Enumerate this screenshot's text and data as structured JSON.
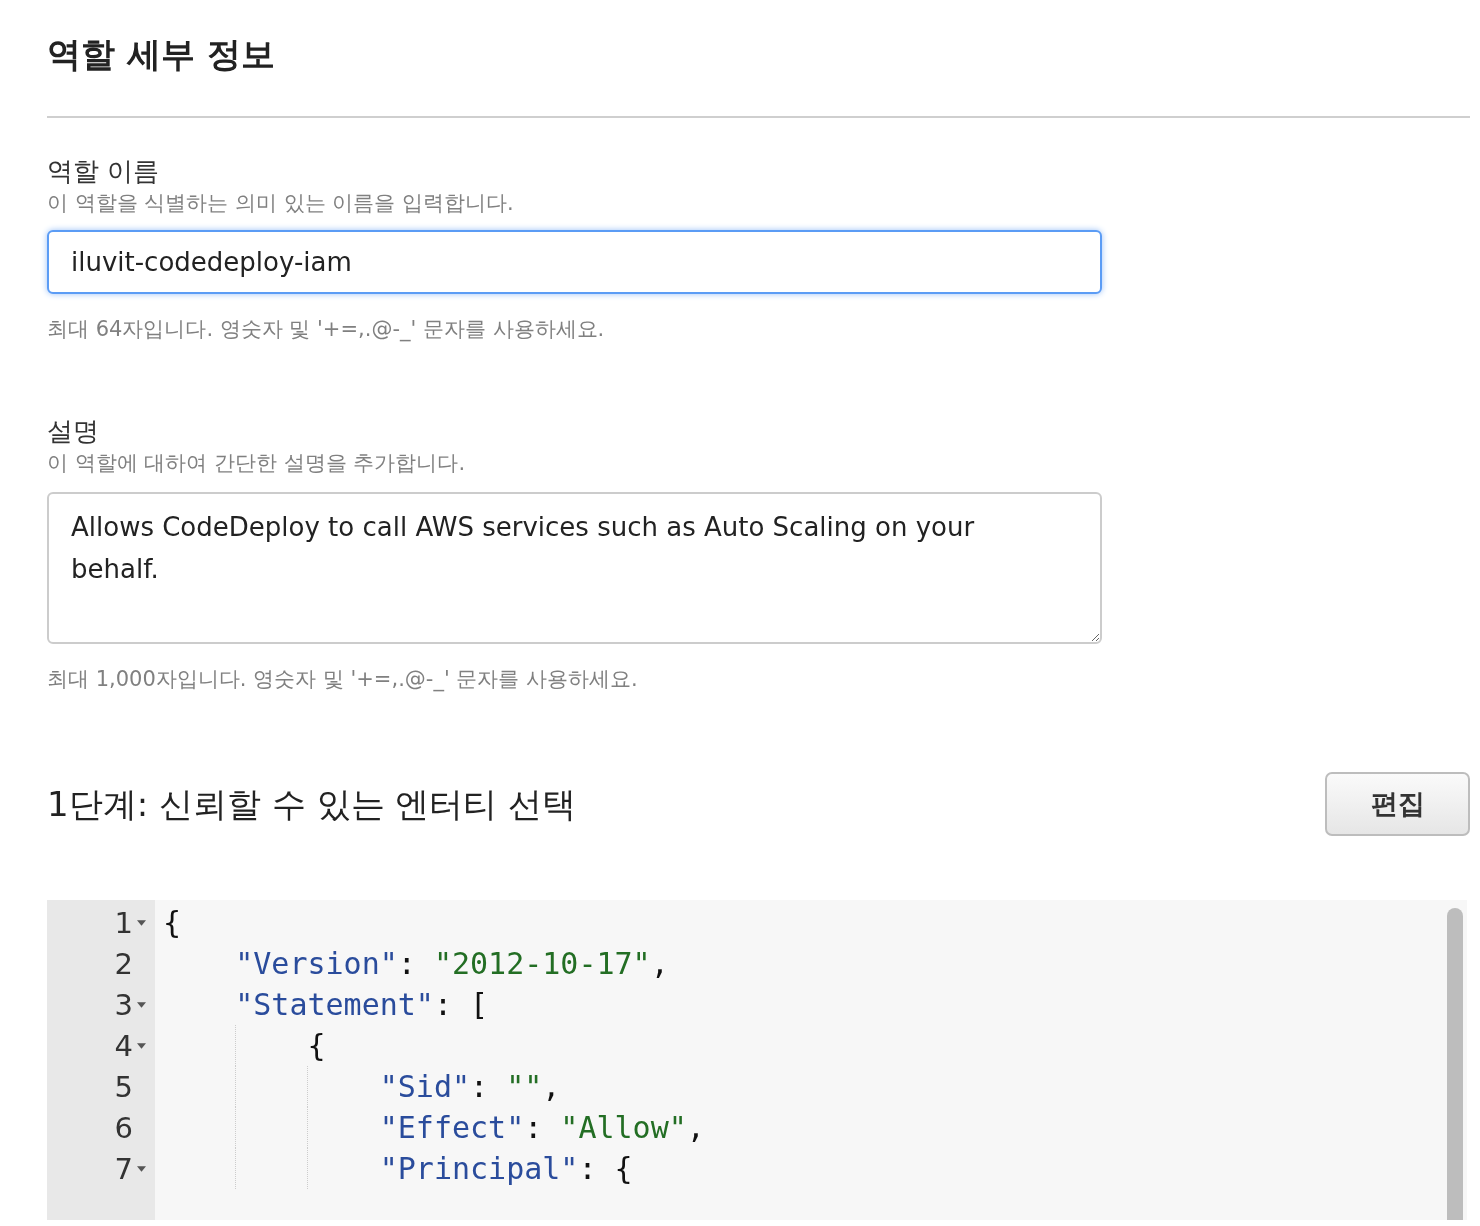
{
  "title": "역할 세부 정보",
  "role_name": {
    "label": "역할 이름",
    "help": "이 역할을 식별하는 의미 있는 이름을 입력합니다.",
    "value": "iluvit-codedeploy-iam",
    "hint": "최대 64자입니다. 영숫자 및 '+=,.@-_' 문자를 사용하세요."
  },
  "description": {
    "label": "설명",
    "help": "이 역할에 대하여 간단한 설명을 추가합니다.",
    "value": "Allows CodeDeploy to call AWS services such as Auto Scaling on your behalf.",
    "hint": "최대 1,000자입니다. 영숫자 및 '+=,.@-_' 문자를 사용하세요."
  },
  "step": {
    "heading": "1단계: 신뢰할 수 있는 엔터티 선택",
    "edit_button": "편집"
  },
  "editor": {
    "lines": [
      {
        "number": "1",
        "foldable": true,
        "tokens": [
          {
            "kind": "punct",
            "text": "{"
          }
        ]
      },
      {
        "number": "2",
        "foldable": false,
        "tokens": [
          {
            "kind": "key",
            "text": "    \"Version\""
          },
          {
            "kind": "punct",
            "text": ": "
          },
          {
            "kind": "string",
            "text": "\"2012-10-17\""
          },
          {
            "kind": "punct",
            "text": ","
          }
        ]
      },
      {
        "number": "3",
        "foldable": true,
        "tokens": [
          {
            "kind": "key",
            "text": "    \"Statement\""
          },
          {
            "kind": "punct",
            "text": ": ["
          }
        ]
      },
      {
        "number": "4",
        "foldable": true,
        "tokens": [
          {
            "kind": "punct",
            "text": "        {"
          }
        ]
      },
      {
        "number": "5",
        "foldable": false,
        "tokens": [
          {
            "kind": "key",
            "text": "            \"Sid\""
          },
          {
            "kind": "punct",
            "text": ": "
          },
          {
            "kind": "string",
            "text": "\"\""
          },
          {
            "kind": "punct",
            "text": ","
          }
        ]
      },
      {
        "number": "6",
        "foldable": false,
        "tokens": [
          {
            "kind": "key",
            "text": "            \"Effect\""
          },
          {
            "kind": "punct",
            "text": ": "
          },
          {
            "kind": "string",
            "text": "\"Allow\""
          },
          {
            "kind": "punct",
            "text": ","
          }
        ]
      },
      {
        "number": "7",
        "foldable": true,
        "tokens": [
          {
            "kind": "key",
            "text": "            \"Principal\""
          },
          {
            "kind": "punct",
            "text": ": {"
          }
        ]
      }
    ]
  }
}
